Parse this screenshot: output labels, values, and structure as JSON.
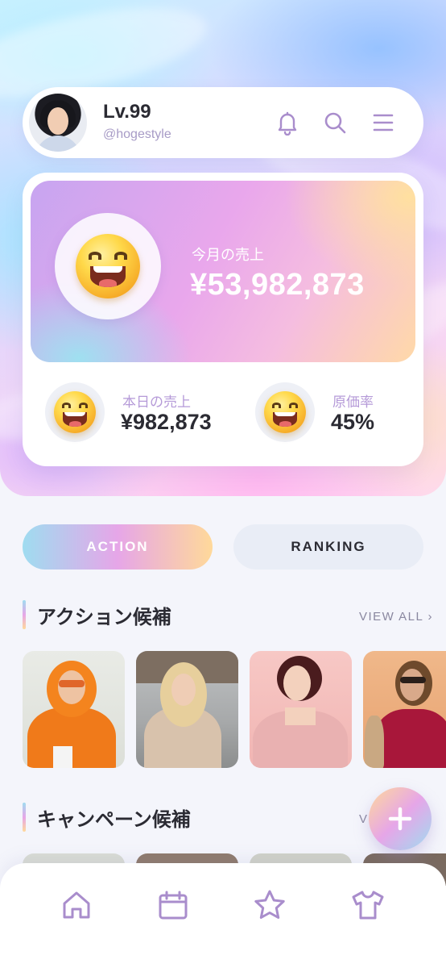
{
  "header": {
    "level": "Lv.99",
    "handle": "@hogestyle",
    "icons": [
      "bell-icon",
      "search-icon",
      "menu-icon"
    ]
  },
  "sales": {
    "monthly_label": "今月の売上",
    "monthly_value": "¥53,982,873",
    "daily_label": "本日の売上",
    "daily_value": "¥982,873",
    "cost_label": "原価率",
    "cost_value": "45%"
  },
  "tabs": {
    "action": "ACTION",
    "ranking": "RANKING",
    "selected": "ACTION"
  },
  "sections": {
    "action": {
      "title": "アクション候補",
      "view_all": "VIEW ALL ›"
    },
    "campaign": {
      "title": "キャンペーン候補",
      "view_all": "V"
    }
  },
  "fab": {
    "icon": "plus-icon"
  },
  "nav": {
    "items": [
      "home-icon",
      "calendar-icon",
      "star-icon",
      "shirt-icon"
    ]
  },
  "colors": {
    "accent": "#a98dcc",
    "text": "#2b2b33",
    "muted": "#b59ad8",
    "background": "#f4f5fb"
  }
}
